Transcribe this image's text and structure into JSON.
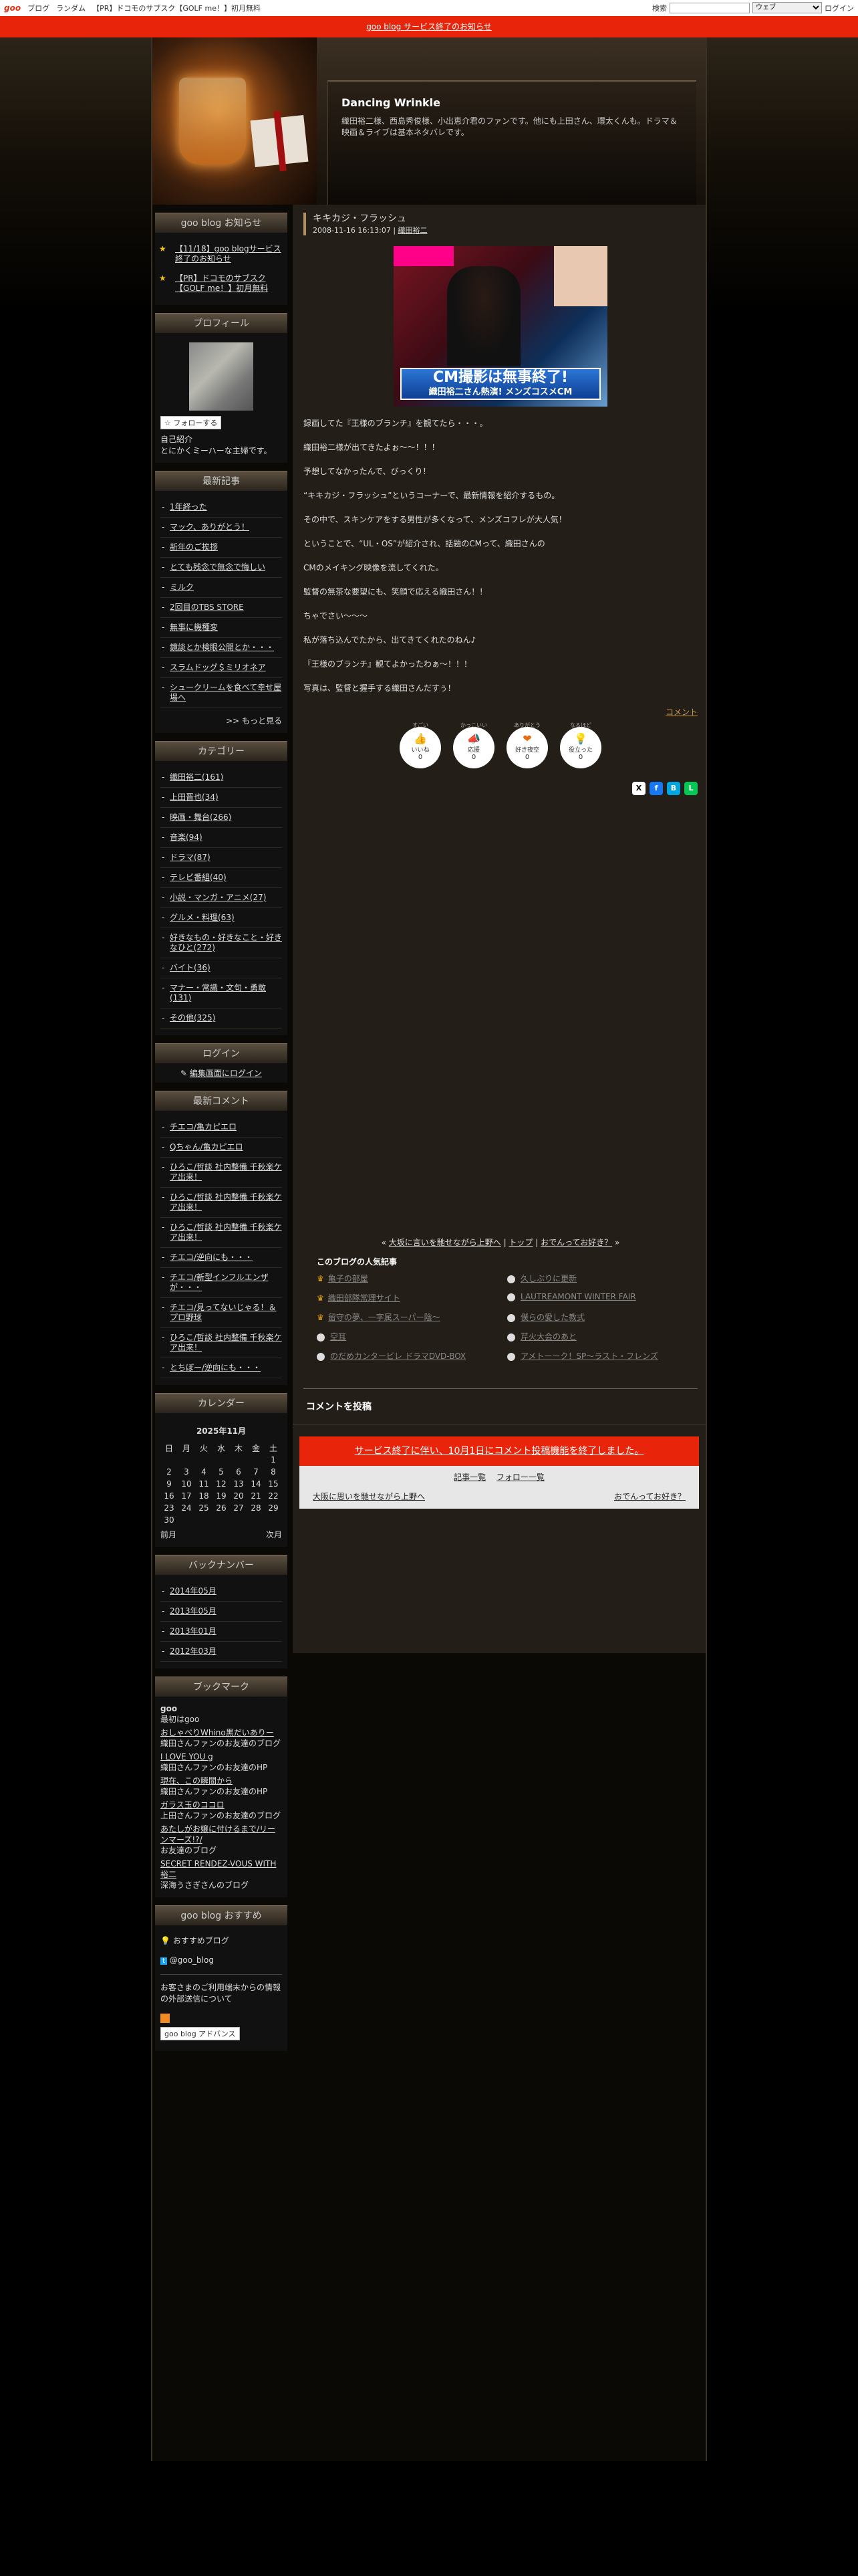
{
  "topbar": {
    "logo": "goo",
    "nav": [
      "ブログ",
      "ランダム",
      "【PR】ドコモのサブスク【GOLF me！】初月無料"
    ],
    "search_label": "検索",
    "search_value": "",
    "search_select": "ウェブ",
    "login": "ログイン"
  },
  "notice": "goo blog サービス終了のお知らせ",
  "header": {
    "title": "Dancing Wrinkle",
    "description": "織田裕二様、西島秀俊様、小出恵介君のファンです。他にも上田さん、環太くんも。ドラマ＆映画＆ライブは基本ネタバレです。"
  },
  "sidebar": {
    "news": {
      "heading": "goo blog お知らせ",
      "items": [
        "【11/18】goo blogサービス終了のお知らせ",
        "【PR】ドコモのサブスク【GOLF me！】初月無料"
      ]
    },
    "profile": {
      "heading": "プロフィール",
      "follow": "フォローする",
      "intro_label": "自己紹介",
      "intro": "とにかくミーハーな主婦です。"
    },
    "recent": {
      "heading": "最新記事",
      "items": [
        "1年経った",
        "マック、ありがとう！",
        "新年のご挨拶",
        "とても残念で無念で悔しい",
        "ミルク",
        "2回目のTBS STORE",
        "無事に機種変",
        "鏡談とか検眼公開とか・・・",
        "スラムドッグ＄ミリオネア",
        "シュークリームを食べて幸せ屋場へ"
      ],
      "more": ">> もっと見る"
    },
    "categories": {
      "heading": "カテゴリー",
      "items": [
        "織田裕二(161)",
        "上田晋也(34)",
        "映画・舞台(266)",
        "音楽(94)",
        "ドラマ(87)",
        "テレビ番組(40)",
        "小説・マンガ・アニメ(27)",
        "グルメ・料理(63)",
        "好きなもの・好きなこと・好きなひと(272)",
        "バイト(36)",
        "マナー・常識・文句・勇敢(131)",
        "その他(325)"
      ]
    },
    "login": {
      "heading": "ログイン",
      "link": "編集画面にログイン"
    },
    "comments": {
      "heading": "最新コメント",
      "items": [
        "チエコ/亀カピエロ",
        "Qちゃん/亀カピエロ",
        "ひろこ/哲談 社内整備 千秋楽ケア出来！",
        "ひろこ/哲談 社内整備 千秋楽ケア出来！",
        "ひろこ/哲談 社内整備 千秋楽ケア出来！",
        "チエコ/逆向にも・・・",
        "チエコ/新型インフルエンザが・・・",
        "チエコ/見ってないじゃる！＆プロ野球",
        "ひろこ/哲談 社内整備 千秋楽ケア出来！",
        "とちぼー/逆向にも・・・"
      ]
    },
    "calendar": {
      "heading": "カレンダー",
      "month": "2025年11月",
      "weekdays": [
        "日",
        "月",
        "火",
        "水",
        "木",
        "金",
        "土"
      ],
      "weeks": [
        [
          "",
          "",
          "",
          "",
          "",
          "",
          "1"
        ],
        [
          "2",
          "3",
          "4",
          "5",
          "6",
          "7",
          "8"
        ],
        [
          "9",
          "10",
          "11",
          "12",
          "13",
          "14",
          "15"
        ],
        [
          "16",
          "17",
          "18",
          "19",
          "20",
          "21",
          "22"
        ],
        [
          "23",
          "24",
          "25",
          "26",
          "27",
          "28",
          "29"
        ],
        [
          "30",
          "",
          "",
          "",
          "",
          "",
          ""
        ]
      ],
      "prev": "前月",
      "next": "次月"
    },
    "backnumber": {
      "heading": "バックナンバー",
      "items": [
        "2014年05月",
        "2013年05月",
        "2013年01月",
        "2012年03月"
      ]
    },
    "bookmarks": {
      "heading": "ブックマーク",
      "items": [
        {
          "title": "goo",
          "desc": "最初はgoo",
          "link": false
        },
        {
          "title": "おしゃべりWhino黒だいありー",
          "desc": "織田さんファンのお友達のブログ",
          "link": true
        },
        {
          "title": "I LOVE YOU g",
          "desc": "織田さんファンのお友達のHP",
          "link": true
        },
        {
          "title": "現在、この瞬間から",
          "desc": "織田さんファンのお友達のHP",
          "link": true
        },
        {
          "title": "ガラス玉のココロ",
          "desc": "上田さんファンのお友達のブログ",
          "link": true
        },
        {
          "title": "あたしがお嬢に付けるまで/リーンマーズ!?/",
          "desc": "お友達のブログ",
          "link": true
        },
        {
          "title": "SECRET RENDEZ-VOUS WITH 裕二",
          "desc": "深海うさぎさんのブログ",
          "link": true
        }
      ]
    },
    "recommend": {
      "heading": "goo blog おすすめ",
      "blog": "おすすめブログ",
      "twitter": "@goo_blog",
      "privacy": "お客さまのご利用端末からの情報の外部送信について",
      "adv": "goo blog アドバンス"
    }
  },
  "entry": {
    "title": "キキカジ・フラッシュ",
    "date": "2008-11-16 16:13:07",
    "category": "織田裕二",
    "photo_banner": "CM撮影は無事終了!",
    "photo_sub": "織田裕二さん熱演! メンズコスメCM",
    "paragraphs": [
      "録画してた『王様のブランチ』を観てたら・・・。",
      "織田裕二様が出てきたよぉ～～！！！",
      "予想してなかったんで、びっくり！",
      "“キキカジ・フラッシュ”というコーナーで、最新情報を紹介するもの。",
      "その中で、スキンケアをする男性が多くなって、メンズコフレが大人気！",
      "ということで、“UL・OS”が紹介され、話題のCMって、織田さんの",
      "CMのメイキング映像を流してくれた。",
      "監督の無茶な要望にも、笑顔で応える織田さん！！",
      "ちゃでさい～～～",
      "私が落ち込んでたから、出てきてくれたのねん♪",
      "『王様のブランチ』観てよかったわぁ～！！！",
      "写真は、監督と握手する織田さんだすぅ！"
    ],
    "comment_link": "コメント",
    "reactions": [
      {
        "top": "すごい",
        "name": "いいね",
        "count": "0"
      },
      {
        "top": "かっこいい",
        "name": "応援",
        "count": "0"
      },
      {
        "top": "ありがとう",
        "name": "好き夜空",
        "count": "0"
      },
      {
        "top": "なるほど",
        "name": "役立った",
        "count": "0"
      }
    ],
    "pager": {
      "prev": "大坂に言いを馳せながら上野へ",
      "top": "トップ",
      "next": "おでんってお好き？"
    },
    "popular": {
      "heading": "このブログの人気記事",
      "items": [
        {
          "rank": "crown",
          "text": "亀子の部屋"
        },
        {
          "rank": "dot",
          "text": "久しぶりに更新"
        },
        {
          "rank": "crown",
          "text": "織田部隊常理サイト"
        },
        {
          "rank": "dot",
          "text": "LAUTREAMONT WINTER FAIR"
        },
        {
          "rank": "crown",
          "text": "留守の夢、一字属スーパー陰～"
        },
        {
          "rank": "dot",
          "text": "僕らの愛した教式"
        },
        {
          "rank": "dot",
          "text": "空耳"
        },
        {
          "rank": "dot",
          "text": "芹火大会のあと"
        },
        {
          "rank": "dot",
          "text": "のだめカンタービレ ドラマDVD-BOX"
        },
        {
          "rank": "dot",
          "text": "アメトーーク！SP～ラスト・フレンズ"
        }
      ]
    },
    "comment_post_title": "コメントを投稿",
    "closed_notice": "サービス終了に伴い、10月1日にコメント投稿機能を終了しました。",
    "sublinks": {
      "list": "記事一覧",
      "follow": "フォロー一覧",
      "prev": "大阪に思いを馳せながら上野へ",
      "next": "おでんってお好き？"
    }
  }
}
